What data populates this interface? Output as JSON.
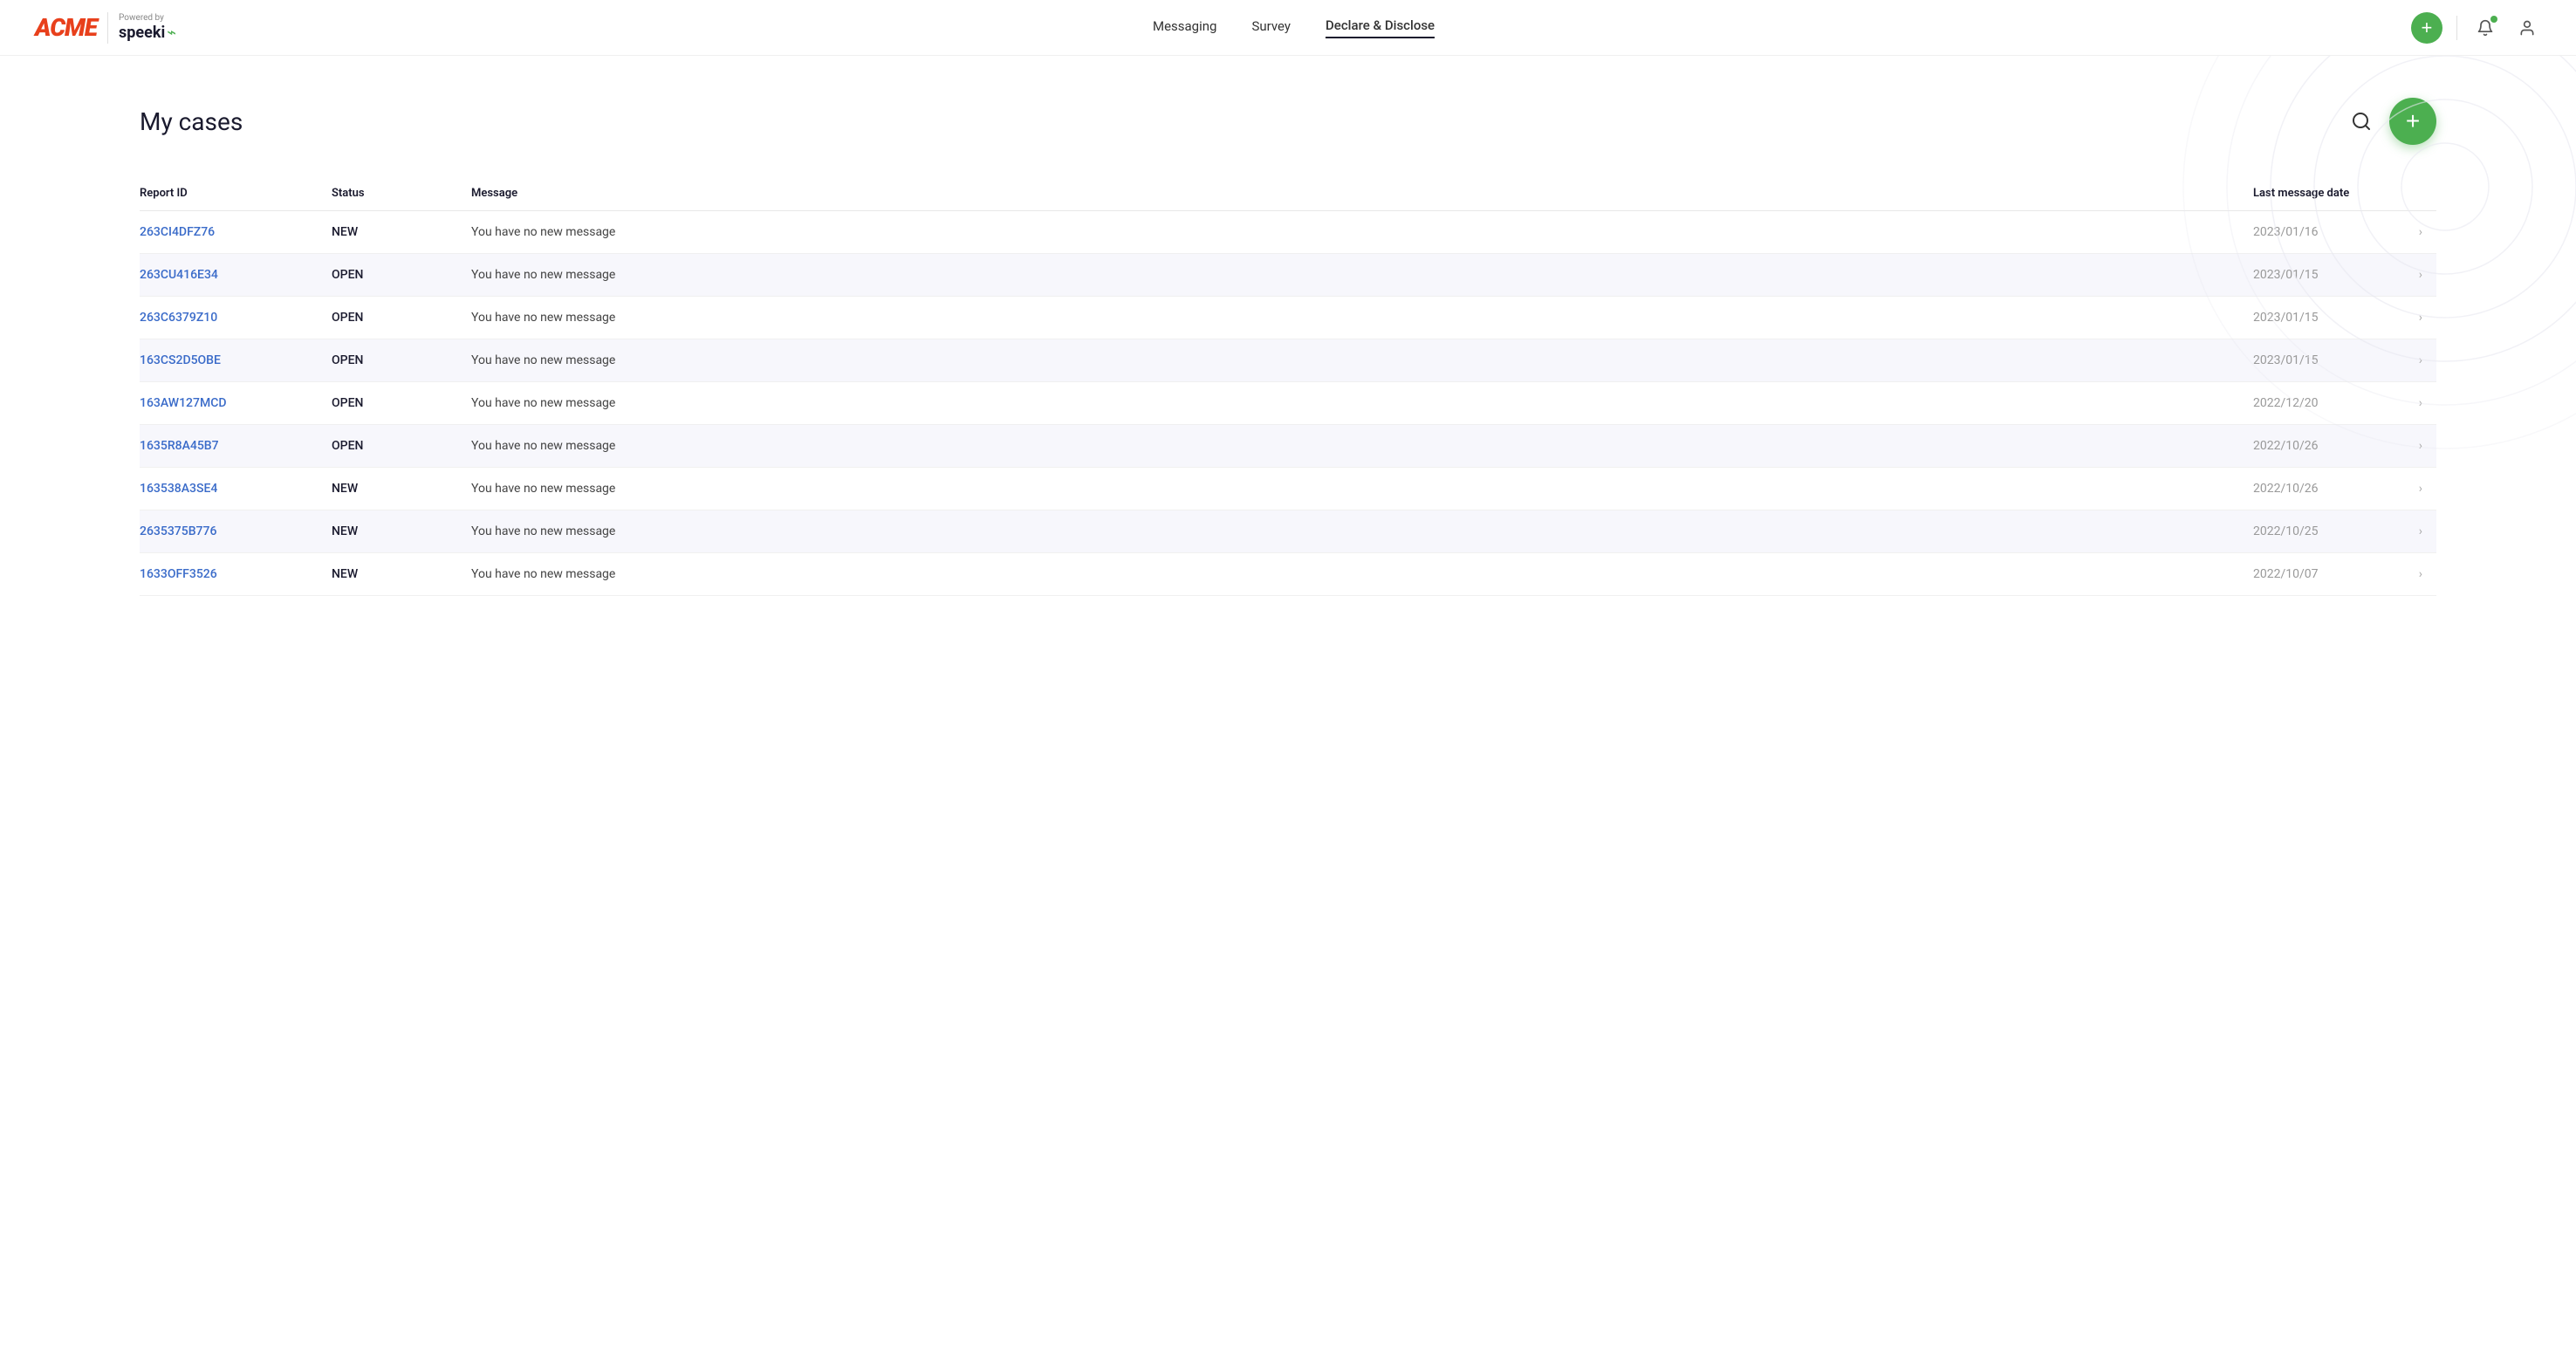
{
  "brand": {
    "acme": "ACME",
    "powered_by": "Powered by",
    "speeki": "speeki"
  },
  "nav": {
    "messaging_label": "Messaging",
    "survey_label": "Survey",
    "declare_disclose_label": "Declare & Disclose"
  },
  "header": {
    "add_button_label": "+"
  },
  "page": {
    "title": "My cases",
    "add_case_label": "+"
  },
  "table": {
    "columns": {
      "report_id": "Report ID",
      "status": "Status",
      "message": "Message",
      "last_message_date": "Last message date"
    },
    "rows": [
      {
        "id": "263CI4DFZ76",
        "status": "NEW",
        "message": "You have no new message",
        "date": "2023/01/16"
      },
      {
        "id": "263CU416E34",
        "status": "OPEN",
        "message": "You have no new message",
        "date": "2023/01/15"
      },
      {
        "id": "263C6379Z10",
        "status": "OPEN",
        "message": "You have no new message",
        "date": "2023/01/15"
      },
      {
        "id": "163CS2D5OBE",
        "status": "OPEN",
        "message": "You have no new message",
        "date": "2023/01/15"
      },
      {
        "id": "163AW127MCD",
        "status": "OPEN",
        "message": "You have no new message",
        "date": "2022/12/20"
      },
      {
        "id": "1635R8A45B7",
        "status": "OPEN",
        "message": "You have no new message",
        "date": "2022/10/26"
      },
      {
        "id": "163538A3SE4",
        "status": "NEW",
        "message": "You have no new message",
        "date": "2022/10/26"
      },
      {
        "id": "2635375B776",
        "status": "NEW",
        "message": "You have no new message",
        "date": "2022/10/25"
      },
      {
        "id": "1633OFF3526",
        "status": "NEW",
        "message": "You have no new message",
        "date": "2022/10/07"
      }
    ]
  }
}
